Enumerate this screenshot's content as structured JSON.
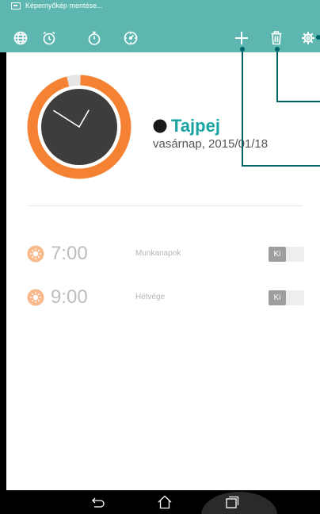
{
  "status_bar": {
    "notification_icon": "screenshot-icon",
    "notification_text": "Képernyőkép mentése..."
  },
  "toolbar": {
    "tabs": [
      {
        "name": "world-clock",
        "icon": "globe-icon"
      },
      {
        "name": "alarm",
        "icon": "alarm-clock-icon"
      },
      {
        "name": "stopwatch",
        "icon": "stopwatch-icon"
      },
      {
        "name": "timer",
        "icon": "timer-icon"
      }
    ],
    "actions": [
      {
        "name": "add",
        "icon": "plus-icon"
      },
      {
        "name": "delete",
        "icon": "trash-icon"
      },
      {
        "name": "settings",
        "icon": "gear-icon"
      }
    ]
  },
  "world_clock": {
    "city": "Tajpej",
    "date": "vasárnap, 2015/01/18",
    "night_icon": "moon-icon",
    "clock_time": "22:05"
  },
  "alarms": [
    {
      "time": "7:00",
      "label": "Munkanapok",
      "toggle": "Ki",
      "enabled": false,
      "icon": "sun-icon"
    },
    {
      "time": "9:00",
      "label": "Hétvége",
      "toggle": "Ki",
      "enabled": false,
      "icon": "sun-icon"
    }
  ],
  "nav_bar": {
    "buttons": [
      {
        "name": "back",
        "icon": "back-icon"
      },
      {
        "name": "home",
        "icon": "home-icon"
      },
      {
        "name": "recent-apps",
        "icon": "recent-apps-icon"
      }
    ]
  },
  "colors": {
    "accent": "#5db7b0",
    "city": "#1aa3a3",
    "orange": "#f58233",
    "alarm_icon": "#f9b98b",
    "clock_face": "#3d3d3d"
  }
}
